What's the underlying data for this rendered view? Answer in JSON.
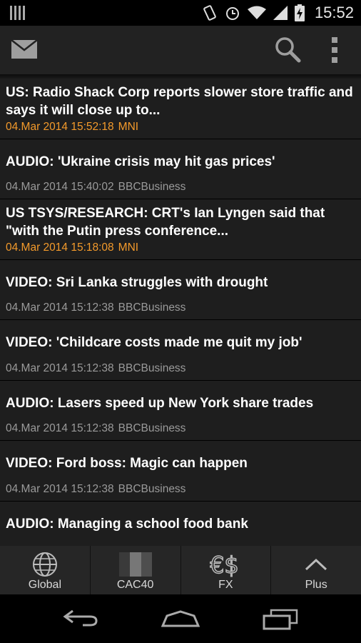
{
  "status_bar": {
    "time": "15:52"
  },
  "articles": [
    {
      "title": "US: Radio Shack Corp reports slower store traffic and says it will close up to...",
      "date": "04.Mar 2014 15:52:18",
      "source": "MNI"
    },
    {
      "title": "AUDIO: 'Ukraine crisis may hit gas prices'",
      "date": "04.Mar 2014 15:40:02",
      "source": "BBCBusiness"
    },
    {
      "title": "US TSYS/RESEARCH: CRT's Ian Lyngen said that \"with the Putin press conference...",
      "date": "04.Mar 2014 15:18:08",
      "source": "MNI"
    },
    {
      "title": "VIDEO: Sri Lanka struggles with drought",
      "date": "04.Mar 2014 15:12:38",
      "source": "BBCBusiness"
    },
    {
      "title": "VIDEO: 'Childcare costs made me quit my job'",
      "date": "04.Mar 2014 15:12:38",
      "source": "BBCBusiness"
    },
    {
      "title": "AUDIO: Lasers speed up New York share trades",
      "date": "04.Mar 2014 15:12:38",
      "source": "BBCBusiness"
    },
    {
      "title": "VIDEO: Ford boss: Magic can happen",
      "date": "04.Mar 2014 15:12:38",
      "source": "BBCBusiness"
    },
    {
      "title": "AUDIO: Managing a school food bank",
      "date": "",
      "source": ""
    }
  ],
  "tabs": [
    {
      "label": "Global",
      "icon": "globe-icon"
    },
    {
      "label": "CAC40",
      "icon": "flag-icon"
    },
    {
      "label": "FX",
      "icon": "currency-icon"
    },
    {
      "label": "Plus",
      "icon": "chevron-up-icon"
    }
  ],
  "colors": {
    "accent_orange": "#f39a2b",
    "meta_gray": "#9a9a9a",
    "list_bg": "#1e1e1e",
    "action_bar_bg": "#222222"
  }
}
